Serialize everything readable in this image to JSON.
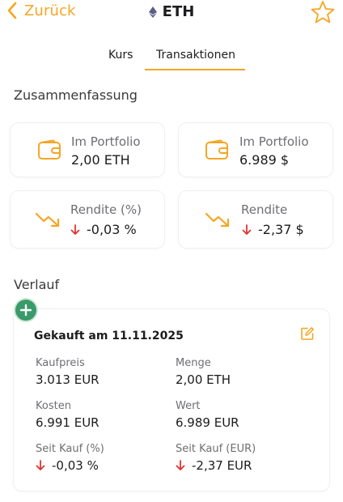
{
  "nav": {
    "back_label": "Zurück",
    "title": "ETH"
  },
  "tabs": [
    {
      "label": "Kurs"
    },
    {
      "label": "Transaktionen"
    }
  ],
  "summary": {
    "heading": "Zusammenfassung",
    "cards": [
      {
        "label": "Im Portfolio",
        "value": "2,00 ETH"
      },
      {
        "label": "Im Portfolio",
        "value": "6.989 $"
      },
      {
        "label": "Rendite (%)",
        "value": "-0,03 %"
      },
      {
        "label": "Rendite",
        "value": "-2,37 $"
      }
    ]
  },
  "history": {
    "heading": "Verlauf",
    "entries": [
      {
        "title": "Gekauft am 11.11.2025",
        "fields": [
          {
            "label": "Kaufpreis",
            "value": "3.013 EUR"
          },
          {
            "label": "Menge",
            "value": "2,00 ETH"
          },
          {
            "label": "Kosten",
            "value": "6.991 EUR"
          },
          {
            "label": "Wert",
            "value": "6.989 EUR"
          },
          {
            "label": "Seit Kauf (%)",
            "value": "-0,03 %"
          },
          {
            "label": "Seit Kauf (EUR)",
            "value": "-2,37 EUR"
          }
        ]
      }
    ]
  },
  "colors": {
    "accent": "#f5a623",
    "negative": "#e0342f",
    "add_button": "#3a9a6a"
  },
  "icons": [
    "chevron-left-icon",
    "ethereum-icon",
    "star-icon",
    "wallet-icon",
    "trend-down-icon",
    "arrow-down-icon",
    "plus-icon",
    "edit-icon"
  ]
}
